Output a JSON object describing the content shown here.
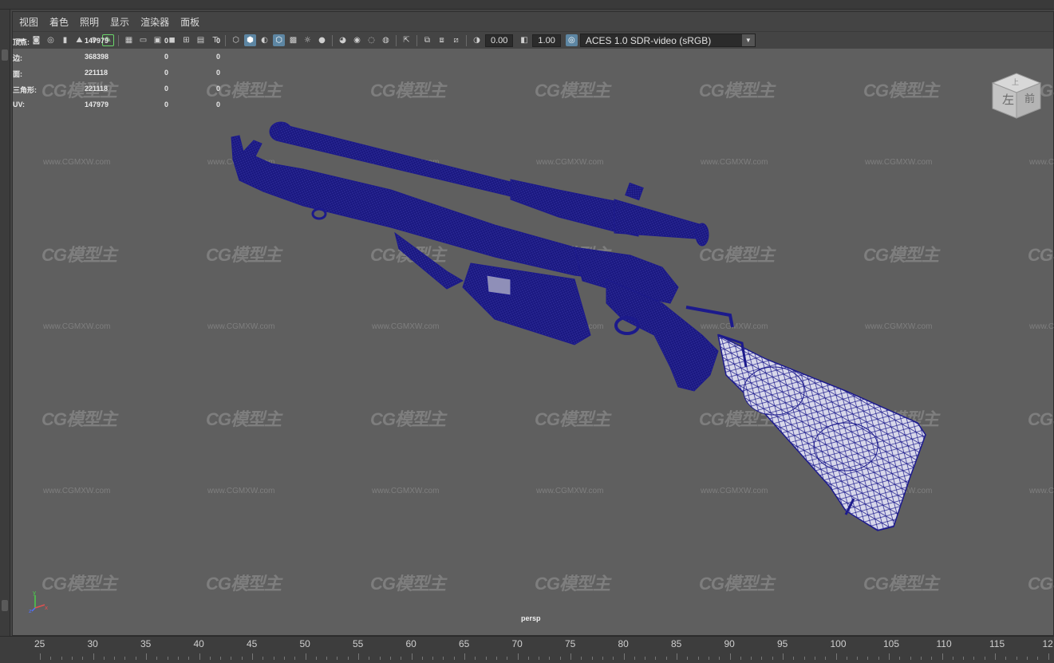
{
  "menubar": {
    "items": [
      "视图",
      "着色",
      "照明",
      "显示",
      "渲染器",
      "面板"
    ]
  },
  "toolbar": {
    "exposure": "0.00",
    "gamma": "1.00",
    "colorspace": "ACES 1.0 SDR-video (sRGB)",
    "icons": [
      "select-camera-icon",
      "camera-attributes-icon",
      "bookmark-icon",
      "image-plane-icon",
      "grease-pencil-icon",
      "2d-pan-zoom-icon",
      "grid-icon",
      "film-gate-icon",
      "resolution-gate-icon",
      "gate-mask-icon",
      "field-chart-icon",
      "safe-action-icon",
      "safe-title-icon",
      "wireframe-icon",
      "smooth-shade-icon",
      "default-material-icon",
      "wireframe-on-shaded-icon",
      "textured-icon",
      "lights-icon",
      "shadows-icon",
      "screen-space-ao-icon",
      "motion-blur-icon",
      "anti-aliasing-icon",
      "depth-of-field-icon",
      "isolate-select-icon",
      "xray-icon",
      "xray-joints-icon",
      "backface-culling-icon",
      "exposure-icon",
      "gamma-icon",
      "color-management-icon"
    ]
  },
  "hud": {
    "rows": [
      {
        "label": "顶点:",
        "v1": "147979",
        "v2": "0",
        "v3": "0"
      },
      {
        "label": "边:",
        "v1": "368398",
        "v2": "0",
        "v3": "0"
      },
      {
        "label": "面:",
        "v1": "221118",
        "v2": "0",
        "v3": "0"
      },
      {
        "label": "三角形:",
        "v1": "221118",
        "v2": "0",
        "v3": "0"
      },
      {
        "label": "UV:",
        "v1": "147979",
        "v2": "0",
        "v3": "0"
      }
    ]
  },
  "viewcube": {
    "left_face": "左",
    "front_face": "前",
    "top_face": "上"
  },
  "camera_label": "persp",
  "axis": {
    "y": "y",
    "x": "x",
    "z": "z"
  },
  "watermark": {
    "logo": "CG模型主",
    "url": "www.CGMXW.com"
  },
  "timeline": {
    "ticks": [
      "25",
      "30",
      "35",
      "40",
      "45",
      "50",
      "55",
      "60",
      "65",
      "70",
      "75",
      "80",
      "85",
      "90",
      "95",
      "100",
      "105",
      "110",
      "115",
      "12"
    ]
  },
  "colors": {
    "wireframe": "#1c1a8c",
    "viewport_bg": "#5f5f5f",
    "ui_bg": "#444444",
    "active_icon": "#5d86a3"
  }
}
